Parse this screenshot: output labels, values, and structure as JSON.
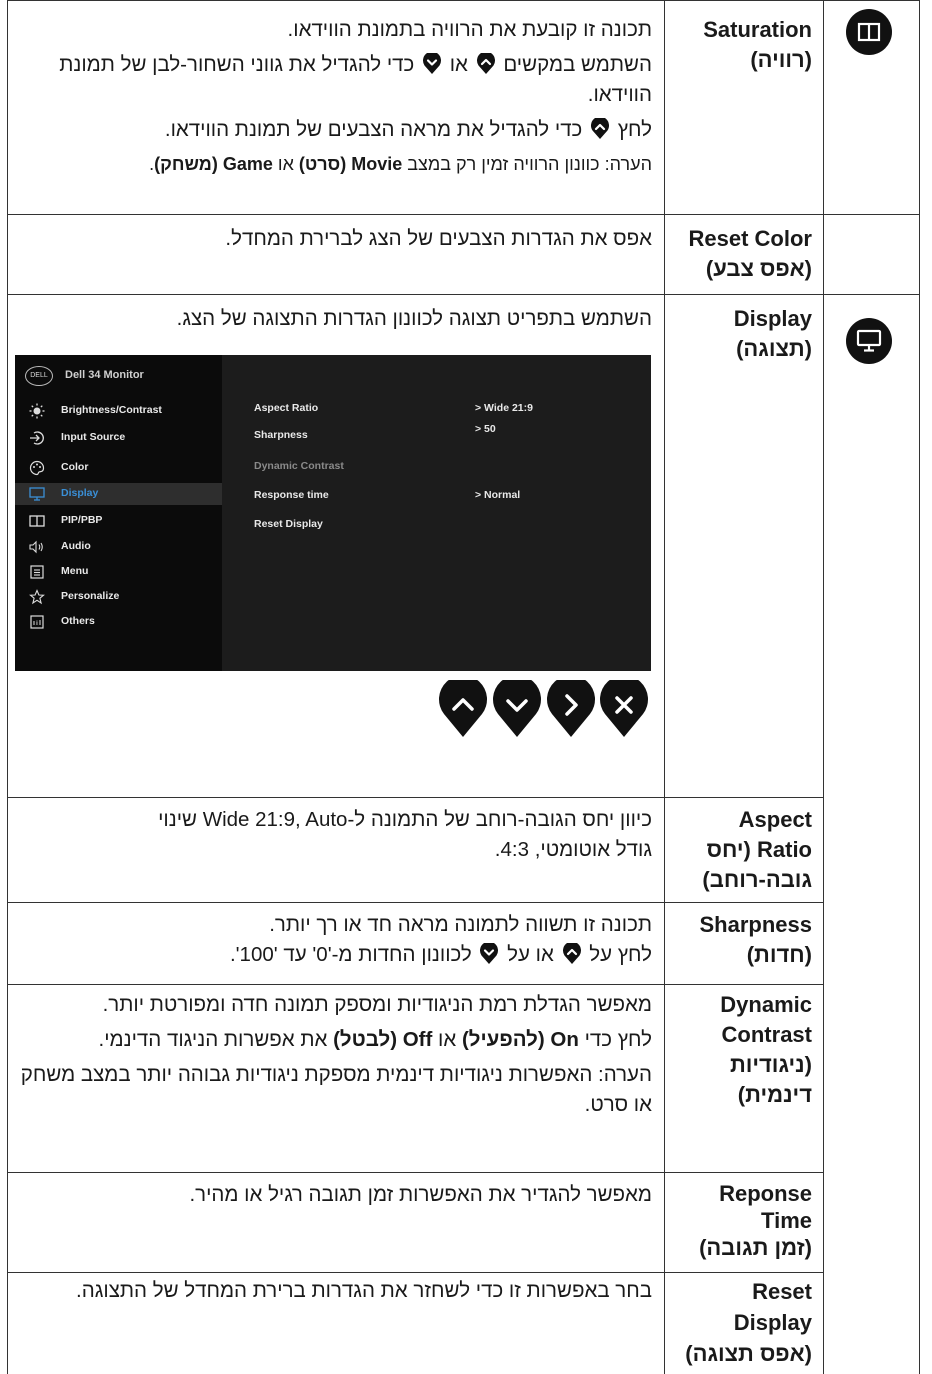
{
  "sections": {
    "saturation": {
      "name_en": "Saturation",
      "name_he": "(רוויה)",
      "line1": "תכונה זו קובעת את הרוויה בתמונת הווידאו.",
      "line2a": "השתמש במקשים",
      "line2b": "או",
      "line2c": "כדי להגדיל את גווני השחור-לבן של תמונת הווידאו.",
      "line3a": "לחץ",
      "line3b": "כדי להגדיל את מראה הצבעים של תמונת הווידאו.",
      "note_a": "הערה: כוונון הרוויה זמין רק במצב",
      "note_movie": "Movie (סרט)",
      "note_or": "או",
      "note_game": "Game (משחק)",
      "note_end": "."
    },
    "reset_color": {
      "name_en": "Reset Color",
      "name_he": "(אפס צבע)",
      "text": "אפס את הגדרות הצבעים של הצג לברירת המחדל."
    },
    "display": {
      "name_en": "Display",
      "name_he": "(תצוגה)",
      "text": "השתמש בתפריט תצוגה לכוונון הגדרות התצוגה של הצג."
    },
    "aspect_ratio": {
      "name_en1": "Aspect",
      "name_en2": "Ratio (יחס",
      "name_he": "גובה-רוחב)",
      "text1": "כיוון יחס הגובה-רוחב של התמונה ל-Wide 21:9, Auto שינוי",
      "text2": "גודל אוטומטי, 4:3."
    },
    "sharpness": {
      "name_en": "Sharpness",
      "name_he": "(חדות)",
      "text1": "תכונה זו תשווה לתמונה מראה חד או רך יותר.",
      "text2a": "לחץ על",
      "text2b": "או על",
      "text2c": "לכוונון החדות מ-'0' עד '100'."
    },
    "dynamic_contrast": {
      "name_en1": "Dynamic",
      "name_en2": "Contrast",
      "name_he1": "(ניגודיות",
      "name_he2": "דינמית)",
      "text1": "מאפשר הגדלת רמת הניגודיות ומספק תמונה חדה ומפורטת יותר.",
      "text2a": "לחץ כדי",
      "text2_on": "On (להפעיל)",
      "text2b": "או",
      "text2_off": "Off (לבטל)",
      "text2c": "את אפשרות הניגוד הדינמי.",
      "text3": "הערה: האפשרות ניגודיות דינמית מספקת ניגודיות גבוהה יותר במצב משחק או סרט."
    },
    "response_time": {
      "name_en1": "Reponse",
      "name_en2": "Time",
      "name_he": "(זמן תגובה)",
      "text": "מאפשר להגדיר את האפשרות זמן תגובה  רגיל או מהיר."
    },
    "reset_display": {
      "name_en1": "Reset",
      "name_en2": "Display",
      "name_he": "(אפס תצוגה)",
      "text": "בחר באפשרות זו כדי לשחזר את הגדרות ברירת המחדל של התצוגה."
    }
  },
  "osd": {
    "logo": "DELL",
    "title": "Dell 34 Monitor",
    "menu": [
      {
        "label": "Brightness/Contrast",
        "icon": "brightness-icon"
      },
      {
        "label": "Input Source",
        "icon": "input-source-icon"
      },
      {
        "label": "Color",
        "icon": "color-palette-icon"
      },
      {
        "label": "Display",
        "icon": "display-icon",
        "selected": true
      },
      {
        "label": "PIP/PBP",
        "icon": "pip-icon"
      },
      {
        "label": "Audio",
        "icon": "audio-icon"
      },
      {
        "label": "Menu",
        "icon": "menu-icon"
      },
      {
        "label": "Personalize",
        "icon": "star-icon"
      },
      {
        "label": "Others",
        "icon": "others-icon"
      }
    ],
    "options": [
      {
        "label": "Aspect Ratio",
        "value": "> Wide 21:9",
        "dim": false
      },
      {
        "label": "Sharpness",
        "value": "> 50",
        "dim": false
      },
      {
        "label": "Dynamic Contrast",
        "value": "",
        "dim": true
      },
      {
        "label": "Response time",
        "value": "> Normal",
        "dim": false
      },
      {
        "label": "Reset Display",
        "value": "",
        "dim": false
      }
    ],
    "nav_buttons": [
      "up-icon",
      "down-icon",
      "right-icon",
      "close-icon"
    ]
  },
  "colors": {
    "osd_bg": "#1c1c1c",
    "osd_sidebar": "#0b0b0b",
    "osd_highlight": "#3a8fd6"
  }
}
